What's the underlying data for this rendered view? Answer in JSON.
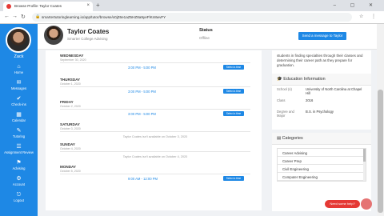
{
  "browser": {
    "tab_title": "Browse Profile: Taylor Coates",
    "tab_close": "×",
    "new_tab": "+",
    "url": "smartertutoringlearning.io/app/tutor/browse/x0jZ6e1aZ5HZ8a9yeFlKn8wvFY",
    "window_controls": "– ▢ ✕",
    "toolbar_icons": "☆ ⋮"
  },
  "sidebar": {
    "user_name": "Zack",
    "items": [
      {
        "label": "Home",
        "icon": "home-icon",
        "glyph": "⌂"
      },
      {
        "label": "Messages",
        "icon": "messages-icon",
        "glyph": "✉"
      },
      {
        "label": "Check-ins",
        "icon": "checkin-icon",
        "glyph": "✔"
      },
      {
        "label": "Calendar",
        "icon": "calendar-icon",
        "glyph": "▦"
      },
      {
        "label": "Tutoring",
        "icon": "tutoring-icon",
        "glyph": "✎"
      },
      {
        "label": "Assignment Review",
        "icon": "review-icon",
        "glyph": "☰"
      },
      {
        "label": "Advising",
        "icon": "advising-icon",
        "glyph": "⚑"
      },
      {
        "label": "Account",
        "icon": "account-icon",
        "glyph": "⚙"
      },
      {
        "label": "Logout",
        "icon": "logout-icon",
        "glyph": "⎋"
      }
    ]
  },
  "header": {
    "tutor_name": "Taylor Coates",
    "tutor_school": "Smarter College Advising",
    "status_label": "Status",
    "status_value": "Offline",
    "message_button": "Send a message to Taylor"
  },
  "schedule": {
    "days": [
      {
        "name": "WEDNESDAY",
        "date": "September 30, 2020",
        "time": "3:00 PM - 5:00 PM",
        "button": "Select a time"
      },
      {
        "name": "THURSDAY",
        "date": "October 1, 2020",
        "time": "3:00 PM - 5:00 PM",
        "button": "Select a time"
      },
      {
        "name": "FRIDAY",
        "date": "October 2, 2020",
        "time": "3:00 PM - 5:00 PM",
        "button": "Select a time"
      },
      {
        "name": "SATURDAY",
        "date": "October 3, 2020",
        "unavailable": "Taylor Coates isn't available on October 3, 2020"
      },
      {
        "name": "SUNDAY",
        "date": "October 4, 2020",
        "unavailable": "Taylor Coates isn't available on October 4, 2020"
      },
      {
        "name": "MONDAY",
        "date": "October 5, 2020",
        "time": "9:00 AM - 12:00 PM",
        "button": "Select a time"
      }
    ]
  },
  "about": {
    "text": "students in finding specialties through their classes and determining their career path as they prepare for graduation."
  },
  "education": {
    "title": "Education Information",
    "icon": "graduation-icon",
    "rows": [
      {
        "key": "School (s)",
        "value": "University of North Carolina at Chapel Hill"
      },
      {
        "key": "Class",
        "value": "2016"
      },
      {
        "key": "Degree and Major",
        "value": "B.S. in Psychology"
      }
    ]
  },
  "categories": {
    "title": "Categories",
    "icon": "folder-icon",
    "items": [
      "Career Advising",
      "Career Prep",
      "Civil Engineering",
      "Computer Engineering"
    ]
  },
  "help": {
    "button": "Need some help?"
  }
}
